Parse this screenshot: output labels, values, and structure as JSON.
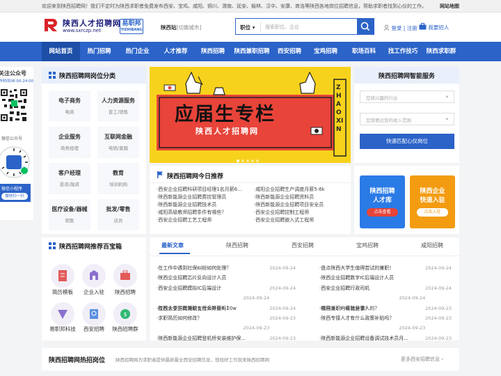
{
  "topbar": {
    "welcome": "欢迎来到陕西招聘网！我们不定时为陕西求职者免费发布西安、宝鸡、咸阳、铜川、渭南、延安、榆林、汉中、安康、商洛等陕西各地岗位招聘信息，帮助求职者找到心仪的工作。",
    "sitemap": "网站地图"
  },
  "header": {
    "logo_name": "陕西人才招聘网",
    "logo_url": "www.sxrczp.net",
    "brand_cn": "易职邦",
    "brand_en": "YIZHIBANG",
    "station_label": "陕西站",
    "station_switch": "[切换城市]",
    "search_type": "职位",
    "search_placeholder": "搜索职位、企业",
    "login": "登录",
    "register": "注册",
    "recruit": "我要招人"
  },
  "nav": [
    "网站首页",
    "热门招聘",
    "热门企业",
    "人才推荐",
    "陕西招聘",
    "陕西兼职招聘",
    "西安招聘",
    "宝鸡招聘",
    "职场百科",
    "找工作技巧",
    "陕西求职群"
  ],
  "sidebar_left": {
    "follow": "关注公众号",
    "hours": "作时间08:00-24:00",
    "wechat_label": "微信公众号",
    "mini_label": "微信小程序",
    "scan": "微信扫一扫"
  },
  "categories": {
    "title": "陕西招聘网岗位分类",
    "items": [
      {
        "t": "电子商务",
        "s": "电商"
      },
      {
        "t": "人力资源服务",
        "s": "普工/销售"
      },
      {
        "t": "企业服务",
        "s": "商务经理"
      },
      {
        "t": "互联网金融",
        "s": "电销/客服"
      },
      {
        "t": "客户经理",
        "s": "投资/融资"
      },
      {
        "t": "教育",
        "s": "培训机构"
      },
      {
        "t": "医疗设备/器械",
        "s": "销售"
      },
      {
        "t": "批发/零售",
        "s": "店员"
      }
    ]
  },
  "banner": {
    "headline": "应届生专栏",
    "subtitle": "陕西人才招聘网",
    "side": "ZHAOXIN"
  },
  "match": {
    "title": "陕西招聘网智能服务",
    "field1": "您感兴趣的行业",
    "field2": "您想要达到的收入范围",
    "button": "快速匹配心仪岗位"
  },
  "today": {
    "title": "陕西招聘网今日推荐",
    "left": [
      "·西安企业招聘科研项目经理1名月薪6...",
      "·陕西新能源企业招聘费控管理员",
      "·陕西新能源企业招聘技术员",
      "·咸阳高级教师招聘条件有哪些？",
      "·西安企业招聘工艺工程师"
    ],
    "right": [
      "·咸阳企业招聘生产调度月薪5-6k",
      "·陕西新能源企业招聘资料员",
      "·陕西新能源企业招聘项目安全员",
      "·西安企业招聘控制工程师",
      "·西安企业招聘嵌入式工程师"
    ]
  },
  "promo": [
    {
      "l1": "陕西招聘",
      "l2": "人才库",
      "btn": "点击查看"
    },
    {
      "l1": "陕西企业",
      "l2": "快速入驻",
      "btn": "点击入驻"
    }
  ],
  "box": {
    "title": "陕西招聘网推荐百宝箱",
    "items": [
      "简历模板",
      "企业入驻",
      "陕西招聘",
      "易职邦科技",
      "西安招聘",
      "陕西招聘群"
    ]
  },
  "tabs": [
    "最新文章",
    "陕西招聘",
    "西安招聘",
    "宝鸡招聘",
    "咸阳招聘"
  ],
  "articles": {
    "left": [
      [
        "·在工作中遇到社保纠纷如何处理？",
        "2024-09-24"
      ],
      [
        "·陕西企业招聘芯片反向设计人员",
        "2024-09-24"
      ],
      [
        "·西安企业招聘模拟IC后端设计",
        "2024-09-24"
      ],
      [
        "·陕西企业招聘测绘工程师年薪6-10w",
        "2024-09-24"
      ],
      [
        "·在校大学生做兼职有什么好处吗？",
        "2024-09-23"
      ],
      [
        "·求职简历如何修改？",
        "2024-09-23"
      ],
      [
        "·陕西新能源企业招聘登机桥安装维护保...",
        "2024-09-23"
      ]
    ],
    "right": [
      [
        "·盘点陕西大学生值得尝试的兼职！",
        "2024-09-24"
      ],
      [
        "·陕西企业招聘数字IC后端设计人员",
        "2024-09-24"
      ],
      [
        "·西安企业招聘行政司机",
        "2024-09-24"
      ],
      [
        "·校园兼职的经验分享！",
        "2024-09-23"
      ],
      [
        "·哪些兼职一看就是骗人的？",
        "2024-09-23"
      ],
      [
        "·陕西专接人才有什么政策补贴吗？",
        "2024-09-23"
      ],
      [
        "·陕西新能源企业招聘设备调试技术员月...",
        "2024-09-23"
      ]
    ]
  },
  "hot": {
    "title": "陕西招聘网热招岗位",
    "desc": "陕西招聘网为求职者提供最新最全西安招聘信息，想找好工作就来陕西招聘网",
    "more": "更多西安招聘信息"
  }
}
